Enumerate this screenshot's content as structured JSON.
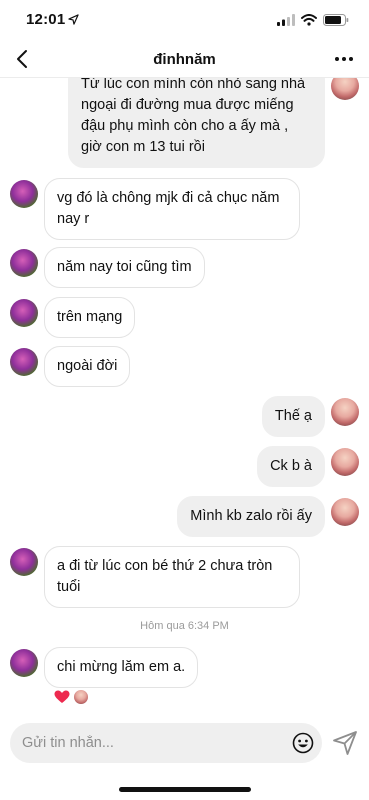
{
  "status": {
    "time": "12:01"
  },
  "header": {
    "title": "đinhnăm"
  },
  "messages": [
    {
      "text": "Từ lúc con mình còn nhỏ sang nhà\nngoại đi đường mua được miếng\nđậu phụ mình còn cho a ấy mà ,\ngiờ con m 13 tui rồi"
    },
    {
      "text": "vg đó là chông mjk đi cả chục năm\nnay r"
    },
    {
      "text": "năm nay toi cũng tìm"
    },
    {
      "text": "trên mạng"
    },
    {
      "text": "ngoài đời"
    },
    {
      "text": "Thế ạ"
    },
    {
      "text": "Ck b à"
    },
    {
      "text": "Mình kb zalo rồi ấy"
    },
    {
      "text": "a đi từ lúc con bé thứ 2 chưa tròn\ntuổi"
    },
    {
      "text": "chi mừng  lăm em a."
    }
  ],
  "timestamp": "Hôm qua 6:34 PM",
  "composer": {
    "placeholder": "Gửi tin nhắn..."
  },
  "icons": {
    "back": "chevron-left-icon",
    "more": "more-horizontal-icon",
    "emoji": "smiley-icon",
    "send": "paper-plane-icon",
    "reaction": "heart-icon"
  },
  "colors": {
    "reaction_heart": "#ed2a4f",
    "incoming_bubble": "#ffffff",
    "outgoing_bubble": "#efefef"
  }
}
